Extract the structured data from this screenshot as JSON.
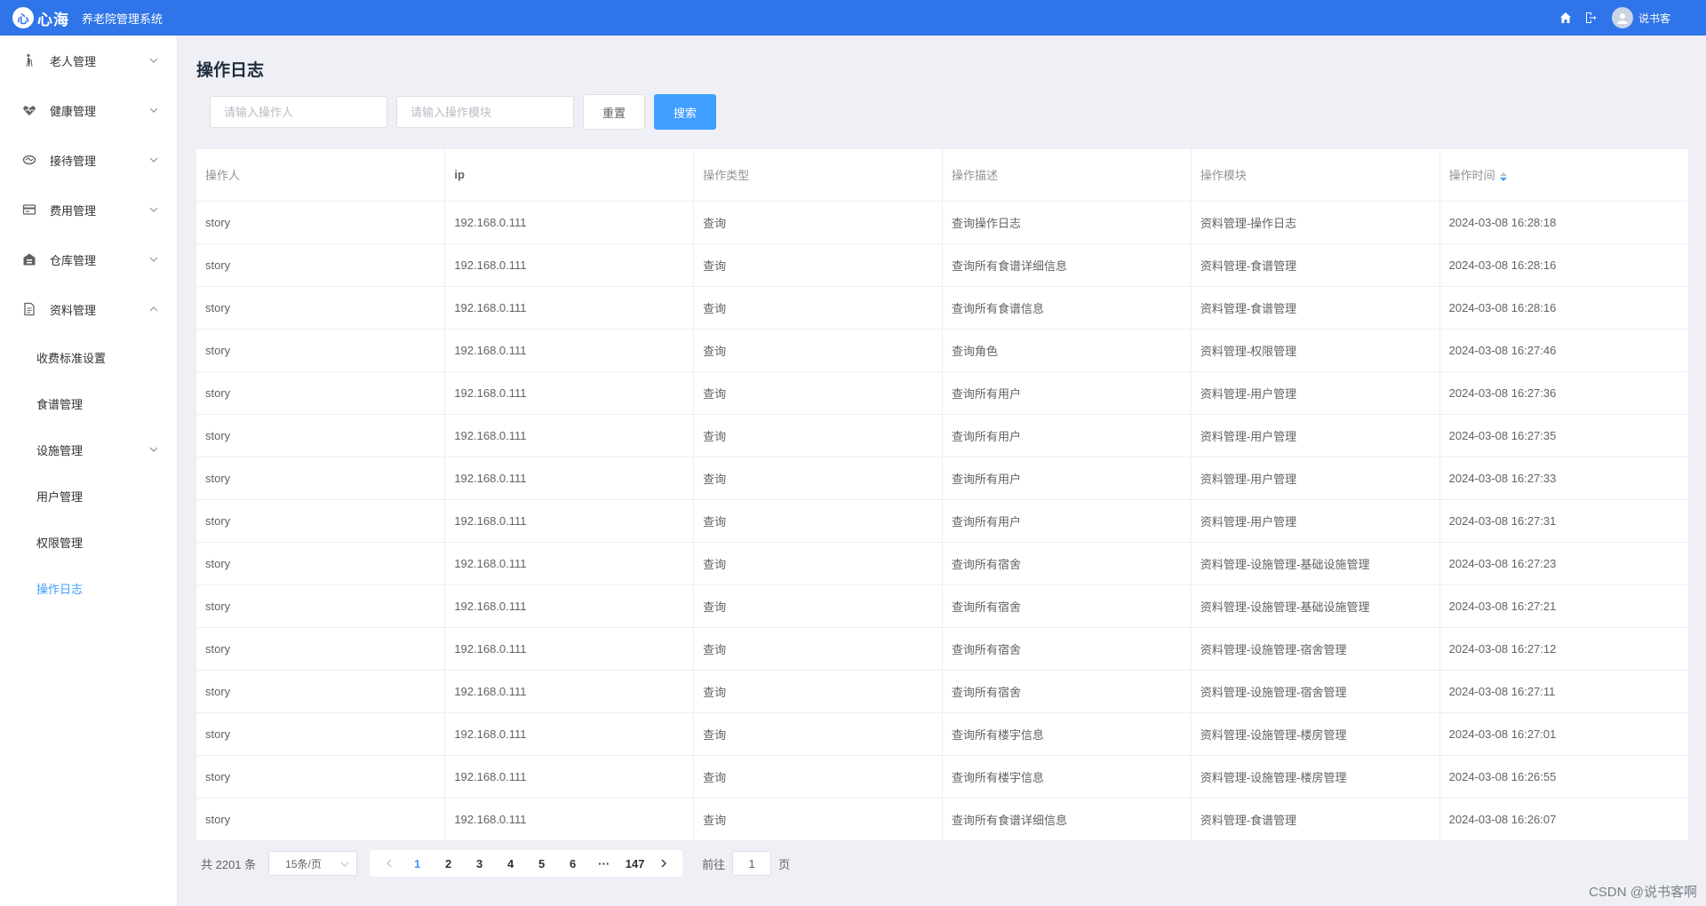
{
  "header": {
    "logo_mark": "心",
    "logo_text": "心海",
    "app_title": "养老院管理系统",
    "username": "说书客",
    "bg_color": "#2f74e8"
  },
  "sidebar": {
    "menus": [
      {
        "label": "老人管理",
        "icon": "elder-icon",
        "expanded": false
      },
      {
        "label": "健康管理",
        "icon": "heart-icon",
        "expanded": false
      },
      {
        "label": "接待管理",
        "icon": "handshake-icon",
        "expanded": false
      },
      {
        "label": "费用管理",
        "icon": "wallet-icon",
        "expanded": false
      },
      {
        "label": "仓库管理",
        "icon": "warehouse-icon",
        "expanded": false
      },
      {
        "label": "资料管理",
        "icon": "document-icon",
        "expanded": true
      }
    ],
    "sub_items": [
      {
        "label": "收费标准设置",
        "active": false
      },
      {
        "label": "食谱管理",
        "active": false
      },
      {
        "label": "设施管理",
        "active": false,
        "has_children": true
      },
      {
        "label": "用户管理",
        "active": false
      },
      {
        "label": "权限管理",
        "active": false
      },
      {
        "label": "操作日志",
        "active": true
      }
    ]
  },
  "main": {
    "title": "操作日志",
    "filters": {
      "operator_placeholder": "请输入操作人",
      "module_placeholder": "请输入操作模块",
      "reset_label": "重置",
      "search_label": "搜索"
    },
    "table": {
      "headers": [
        "操作人",
        "ip",
        "操作类型",
        "操作描述",
        "操作模块",
        "操作时间"
      ],
      "rows": [
        [
          "story",
          "192.168.0.111",
          "查询",
          "查询操作日志",
          "资料管理-操作日志",
          "2024-03-08 16:28:18"
        ],
        [
          "story",
          "192.168.0.111",
          "查询",
          "查询所有食谱详细信息",
          "资料管理-食谱管理",
          "2024-03-08 16:28:16"
        ],
        [
          "story",
          "192.168.0.111",
          "查询",
          "查询所有食谱信息",
          "资料管理-食谱管理",
          "2024-03-08 16:28:16"
        ],
        [
          "story",
          "192.168.0.111",
          "查询",
          "查询角色",
          "资料管理-权限管理",
          "2024-03-08 16:27:46"
        ],
        [
          "story",
          "192.168.0.111",
          "查询",
          "查询所有用户",
          "资料管理-用户管理",
          "2024-03-08 16:27:36"
        ],
        [
          "story",
          "192.168.0.111",
          "查询",
          "查询所有用户",
          "资料管理-用户管理",
          "2024-03-08 16:27:35"
        ],
        [
          "story",
          "192.168.0.111",
          "查询",
          "查询所有用户",
          "资料管理-用户管理",
          "2024-03-08 16:27:33"
        ],
        [
          "story",
          "192.168.0.111",
          "查询",
          "查询所有用户",
          "资料管理-用户管理",
          "2024-03-08 16:27:31"
        ],
        [
          "story",
          "192.168.0.111",
          "查询",
          "查询所有宿舍",
          "资料管理-设施管理-基础设施管理",
          "2024-03-08 16:27:23"
        ],
        [
          "story",
          "192.168.0.111",
          "查询",
          "查询所有宿舍",
          "资料管理-设施管理-基础设施管理",
          "2024-03-08 16:27:21"
        ],
        [
          "story",
          "192.168.0.111",
          "查询",
          "查询所有宿舍",
          "资料管理-设施管理-宿舍管理",
          "2024-03-08 16:27:12"
        ],
        [
          "story",
          "192.168.0.111",
          "查询",
          "查询所有宿舍",
          "资料管理-设施管理-宿舍管理",
          "2024-03-08 16:27:11"
        ],
        [
          "story",
          "192.168.0.111",
          "查询",
          "查询所有楼宇信息",
          "资料管理-设施管理-楼房管理",
          "2024-03-08 16:27:01"
        ],
        [
          "story",
          "192.168.0.111",
          "查询",
          "查询所有楼宇信息",
          "资料管理-设施管理-楼房管理",
          "2024-03-08 16:26:55"
        ],
        [
          "story",
          "192.168.0.111",
          "查询",
          "查询所有食谱详细信息",
          "资料管理-食谱管理",
          "2024-03-08 16:26:07"
        ]
      ]
    },
    "pagination": {
      "total_text": "共 2201 条",
      "page_size": "15条/页",
      "pages": [
        "1",
        "2",
        "3",
        "4",
        "5",
        "6",
        "···",
        "147"
      ],
      "current_page": "1",
      "goto_prefix": "前往",
      "goto_value": "1",
      "goto_suffix": "页"
    }
  },
  "watermark": "CSDN @说书客啊",
  "accent_color": "#409eff"
}
